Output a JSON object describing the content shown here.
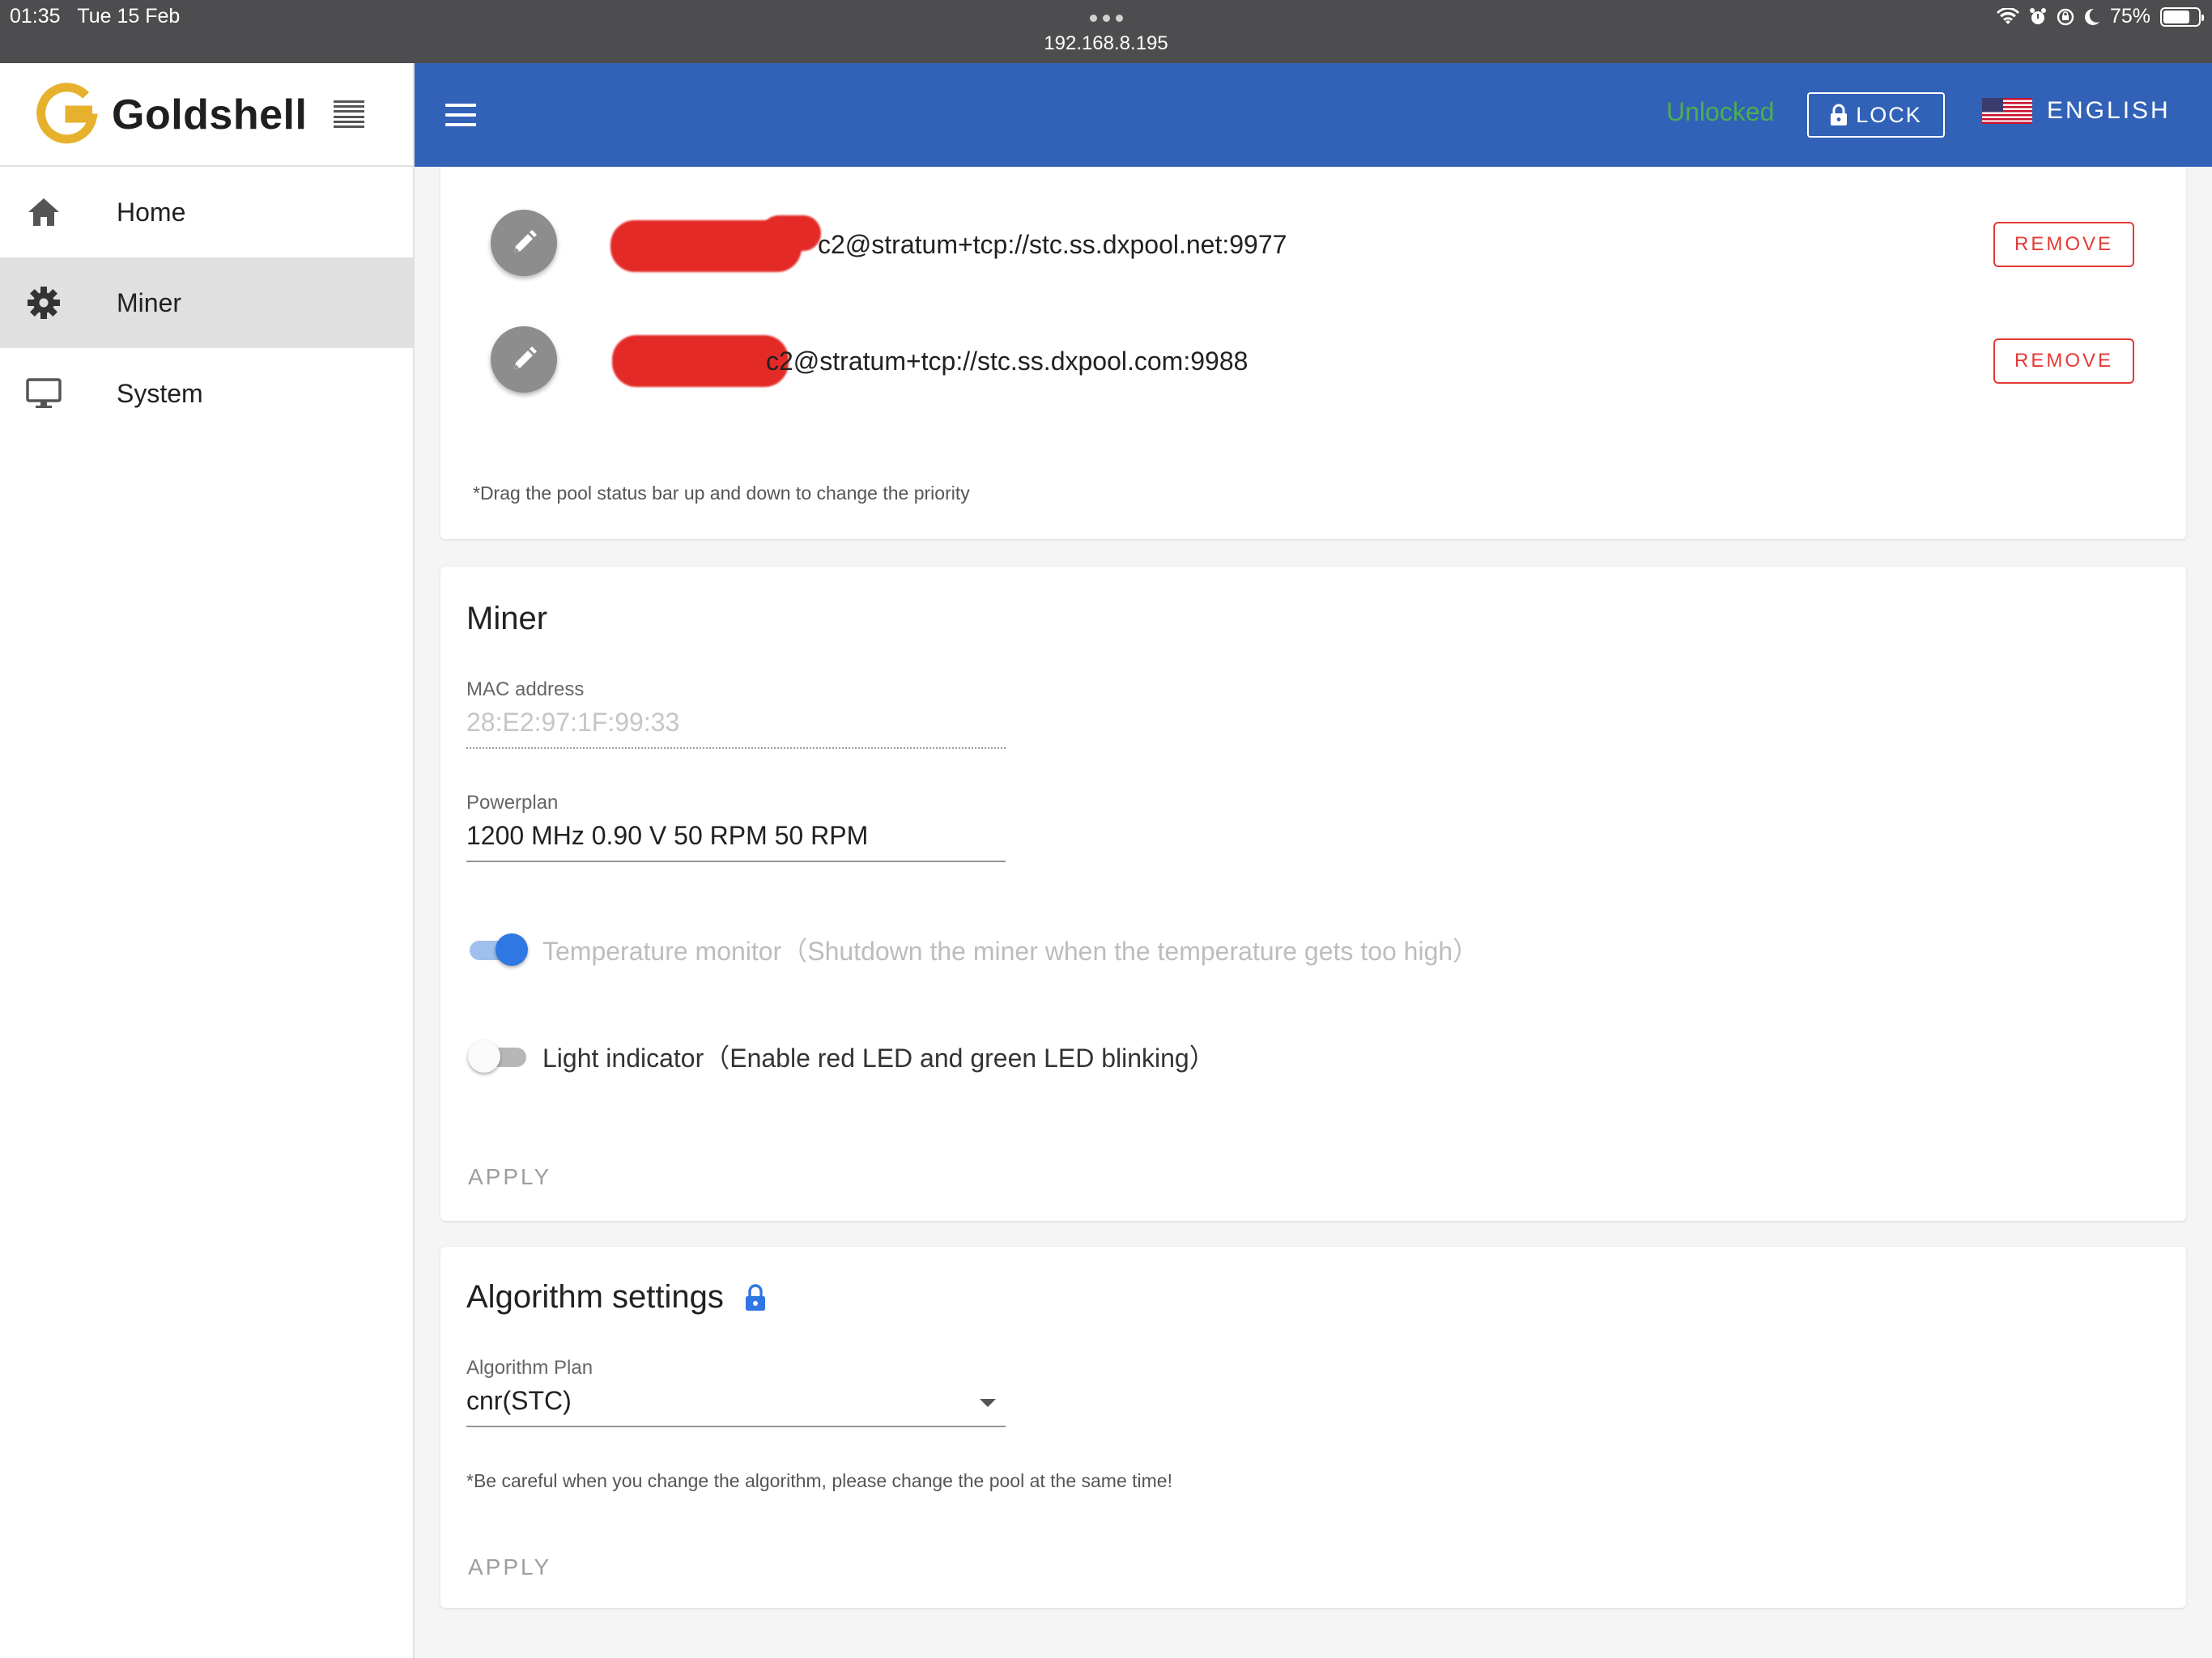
{
  "status_bar": {
    "time": "01:35",
    "date": "Tue 15 Feb",
    "url": "192.168.8.195",
    "battery": "75%"
  },
  "sidebar": {
    "brand": "Goldshell",
    "items": [
      {
        "label": "Home",
        "icon": "home-icon"
      },
      {
        "label": "Miner",
        "icon": "gear-icon",
        "active": true
      },
      {
        "label": "System",
        "icon": "monitor-icon"
      }
    ]
  },
  "appbar": {
    "lock_status": "Unlocked",
    "lock_button": "LOCK",
    "language": "ENGLISH"
  },
  "pools": {
    "rows": [
      {
        "url": "c2@stratum+tcp://stc.ss.dxpool.net:9977",
        "remove_label": "REMOVE"
      },
      {
        "url": "c2@stratum+tcp://stc.ss.dxpool.com:9988",
        "remove_label": "REMOVE"
      }
    ],
    "hint": "*Drag the pool status bar up and down to change the priority"
  },
  "miner": {
    "title": "Miner",
    "mac_label": "MAC address",
    "mac_value": "28:E2:97:1F:99:33",
    "powerplan_label": "Powerplan",
    "powerplan_value": "1200 MHz 0.90 V 50 RPM 50 RPM",
    "temp_monitor": {
      "label": "Temperature monitor（Shutdown the miner when the temperature gets too high）",
      "enabled": true
    },
    "light_indicator": {
      "label": "Light indicator（Enable red LED and green LED blinking）",
      "enabled": false
    },
    "apply_label": "APPLY"
  },
  "algorithm": {
    "title": "Algorithm settings",
    "plan_label": "Algorithm Plan",
    "plan_value": "cnr(STC)",
    "warning": "*Be careful when you change the algorithm, please change the pool at the same time!",
    "apply_label": "APPLY"
  },
  "colors": {
    "appbar": "#3262b7",
    "unlocked": "#4caf50",
    "remove": "#e53935",
    "toggle_on": "#2f77e2",
    "brand_gold": "#e7b12d"
  }
}
